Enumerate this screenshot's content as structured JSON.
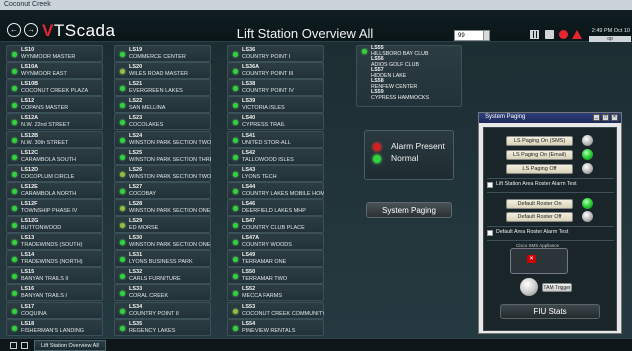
{
  "window": {
    "title": "Coconut Creek"
  },
  "header": {
    "logo_prefix": "V",
    "logo_text": "TScada",
    "page_title": "Lift Station Overview All",
    "number_value": "99",
    "clock": "2:49 PM  Oct 10",
    "user": "op"
  },
  "columns": [
    [
      {
        "code": "LS10",
        "name": "WYNMOOR MASTER",
        "status": "green"
      },
      {
        "code": "LS10A",
        "name": "WYNMOOR EAST",
        "status": "green"
      },
      {
        "code": "LS10B",
        "name": "COCONUT CREEK PLAZA",
        "status": "green"
      },
      {
        "code": "LS12",
        "name": "COPANS MASTER",
        "status": "green"
      },
      {
        "code": "LS12A",
        "name": "N.W. 22nd STREET",
        "status": "green"
      },
      {
        "code": "LS12B",
        "name": "N.W. 30th STREET",
        "status": "green"
      },
      {
        "code": "LS12C",
        "name": "CARAMBOLA SOUTH",
        "status": "green"
      },
      {
        "code": "LS12D",
        "name": "COCOPLUM CIRCLE",
        "status": "green"
      },
      {
        "code": "LS12E",
        "name": "CARAMBOLA NORTH",
        "status": "green"
      },
      {
        "code": "LS12F",
        "name": "TOWNSHIP PHASE IV",
        "status": "green"
      },
      {
        "code": "LS12G",
        "name": "BUTTONWOOD",
        "status": "green"
      },
      {
        "code": "LS13",
        "name": "TRADEWINDS (SOUTH)",
        "status": "green"
      },
      {
        "code": "LS14",
        "name": "TRADEWINDS (NORTH)",
        "status": "green"
      },
      {
        "code": "LS15",
        "name": "BANYAN TRAILS II",
        "status": "green"
      },
      {
        "code": "LS16",
        "name": "BANYAN TRAILS I",
        "status": "green"
      },
      {
        "code": "LS17",
        "name": "COQUINA",
        "status": "green"
      },
      {
        "code": "LS18",
        "name": "FISHERMAN'S LANDING",
        "status": "green"
      }
    ],
    [
      {
        "code": "LS19",
        "name": "COMMERCE CENTER",
        "status": "green"
      },
      {
        "code": "LS20",
        "name": "WILES ROAD MASTER",
        "status": "olive"
      },
      {
        "code": "LS21",
        "name": "EVERGREEN LAKES",
        "status": "green"
      },
      {
        "code": "LS22",
        "name": "SAN MELLINA",
        "status": "green"
      },
      {
        "code": "LS23",
        "name": "COCOLAKES",
        "status": "green"
      },
      {
        "code": "LS24",
        "name": "WINSTON PARK SECTION TWO",
        "status": "green"
      },
      {
        "code": "LS25",
        "name": "WINSTON PARK SECTION THREE",
        "status": "green"
      },
      {
        "code": "LS26",
        "name": "WINSTON PARK SECTION TWO",
        "status": "olive"
      },
      {
        "code": "LS27",
        "name": "COCOBAY",
        "status": "green"
      },
      {
        "code": "LS28",
        "name": "WINSTON PARK SECTION ONE",
        "status": "olive"
      },
      {
        "code": "LS29",
        "name": "ED MORSE",
        "status": "olive"
      },
      {
        "code": "LS30",
        "name": "WINSTON PARK SECTION ONE-A",
        "status": "green"
      },
      {
        "code": "LS31",
        "name": "LYONS BUSINESS PARK",
        "status": "green"
      },
      {
        "code": "LS32",
        "name": "CARLS FURNITURE",
        "status": "green"
      },
      {
        "code": "LS33",
        "name": "CORAL CREEK",
        "status": "green"
      },
      {
        "code": "LS34",
        "name": "COUNTRY POINT II",
        "status": "green"
      },
      {
        "code": "LS35",
        "name": "REGENCY LAKES",
        "status": "green"
      }
    ],
    [
      {
        "code": "LS36",
        "name": "COUNTRY POINT I",
        "status": "green"
      },
      {
        "code": "LS36A",
        "name": "COUNTRY POINT III",
        "status": "green"
      },
      {
        "code": "LS38",
        "name": "COUNTRY POINT IV",
        "status": "green"
      },
      {
        "code": "LS39",
        "name": "VICTORIA ISLES",
        "status": "green"
      },
      {
        "code": "LS40",
        "name": "CYPRESS TRAIL",
        "status": "green"
      },
      {
        "code": "LS41",
        "name": "UNITED STOR-ALL",
        "status": "green"
      },
      {
        "code": "LS42",
        "name": "TALLOWOOD ISLES",
        "status": "green"
      },
      {
        "code": "LS43",
        "name": "LYONS TECH",
        "status": "green"
      },
      {
        "code": "LS44",
        "name": "COUNTRY LAKES MOBILE HOME PARK",
        "status": "green"
      },
      {
        "code": "LS46",
        "name": "DEERFIELD LAKES MHP",
        "status": "green"
      },
      {
        "code": "LS47",
        "name": "COUNTRY CLUB PLACE",
        "status": "green"
      },
      {
        "code": "LS47A",
        "name": "COUNTRY WOODS",
        "status": "green"
      },
      {
        "code": "LS49",
        "name": "TERRAMAR ONE",
        "status": "green"
      },
      {
        "code": "LS50",
        "name": "TERRAMAR TWO",
        "status": "green"
      },
      {
        "code": "LS52",
        "name": "MECCA FARMS",
        "status": "green"
      },
      {
        "code": "LS53",
        "name": "COCONUT CREEK COMMUNITY CENTER",
        "status": "olive"
      },
      {
        "code": "LS54",
        "name": "PINEVIEW RENTALS",
        "status": "green"
      }
    ]
  ],
  "fourth_column": [
    {
      "code": "LS55",
      "name": "HILLSBORO BAY CLUB"
    },
    {
      "code": "LS56",
      "name": "ADIOS GOLF CLUB"
    },
    {
      "code": "LS57",
      "name": "HIDDEN LAKE"
    },
    {
      "code": "LS58",
      "name": "RENFEW CENTER"
    },
    {
      "code": "LS59",
      "name": "CYPRESS HAMMOCKS"
    }
  ],
  "legend": {
    "alarm": "Alarm Present",
    "normal": "Normal"
  },
  "system_paging_button": "System Paging",
  "paging_window": {
    "title": "System Paging",
    "buttons": [
      {
        "label": "LS Paging On (SMS)",
        "led": "gray"
      },
      {
        "label": "LS Paging On (Email)",
        "led": "green"
      },
      {
        "label": "LS Paging Off",
        "led": "gray"
      }
    ],
    "alarm_test_label": "Lift Station Area Roster Alarm Test",
    "roster_buttons": [
      {
        "label": "Default Roster On",
        "led": "green"
      },
      {
        "label": "Default Roster Off",
        "led": "gray"
      }
    ],
    "roster_test_label": "Default Area Roster Alarm Test",
    "sms_label": "Cisco SMS Appliance",
    "tam_label": "TAM Trigger",
    "fiu_label": "FIU Stats"
  },
  "colors": {
    "green": "#2fd33a",
    "olive": "#a3b83a",
    "red": "#d21f1f"
  },
  "bottom_tab": "Lift Station Overview All"
}
